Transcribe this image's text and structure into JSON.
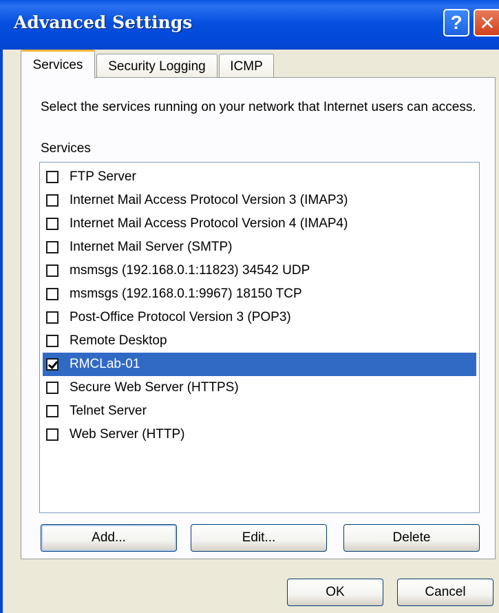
{
  "window": {
    "title": "Advanced Settings",
    "help_glyph": "?",
    "close_glyph": "✕"
  },
  "tabs": [
    {
      "label": "Services",
      "active": true
    },
    {
      "label": "Security Logging",
      "active": false
    },
    {
      "label": "ICMP",
      "active": false
    }
  ],
  "services_tab": {
    "description": "Select the services running on your network that Internet users can access.",
    "list_label": "Services",
    "items": [
      {
        "label": "FTP Server",
        "checked": false
      },
      {
        "label": "Internet Mail Access Protocol Version 3 (IMAP3)",
        "checked": false
      },
      {
        "label": "Internet Mail Access Protocol Version 4 (IMAP4)",
        "checked": false
      },
      {
        "label": "Internet Mail Server (SMTP)",
        "checked": false
      },
      {
        "label": "msmsgs (192.168.0.1:11823) 34542 UDP",
        "checked": false
      },
      {
        "label": "msmsgs (192.168.0.1:9967) 18150 TCP",
        "checked": false
      },
      {
        "label": "Post-Office Protocol Version 3 (POP3)",
        "checked": false
      },
      {
        "label": "Remote Desktop",
        "checked": false
      },
      {
        "label": "RMCLab-01",
        "checked": true,
        "selected": true
      },
      {
        "label": "Secure Web Server (HTTPS)",
        "checked": false
      },
      {
        "label": "Telnet Server",
        "checked": false
      },
      {
        "label": "Web Server (HTTP)",
        "checked": false
      }
    ],
    "buttons": {
      "add": "Add...",
      "edit": "Edit...",
      "delete": "Delete"
    }
  },
  "dialog_buttons": {
    "ok": "OK",
    "cancel": "Cancel"
  },
  "colors": {
    "titlebar": "#0550e0",
    "selection": "#316ac5",
    "active_tab_accent": "#f7b33b"
  }
}
